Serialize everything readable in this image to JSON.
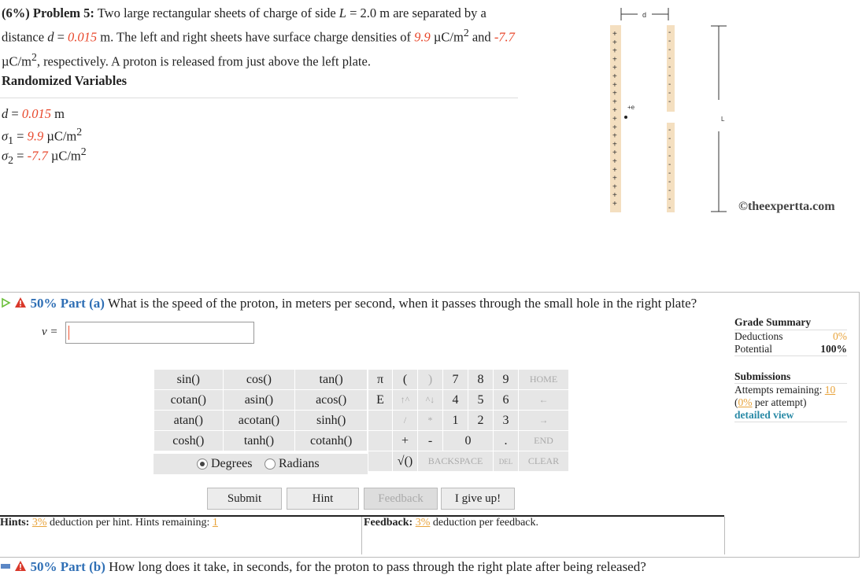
{
  "problem": {
    "header": "(6%) Problem 5:",
    "text_1": "Two large rectangular sheets of charge of side",
    "L_sym": "L",
    "text_2": "= 2.0 m are separated by a distance",
    "d_sym": "d",
    "d_eq": "=",
    "d_val": "0.015",
    "text_3": "m. The left and right sheets have surface charge densities of",
    "s1_val": "9.9",
    "s1_unit": "µC/m",
    "text_4": "and",
    "s2_val": "-7.7",
    "s2_unit": "µC/m",
    "text_5": ", respectively. A proton is released from just above the left plate.",
    "sq": "2"
  },
  "randomized": {
    "title": "Randomized Variables",
    "d_line": {
      "sym": "d",
      "eq": "=",
      "val": "0.015",
      "unit": "m"
    },
    "s1_line": {
      "sym": "σ",
      "sub": "1",
      "eq": "=",
      "val": "9.9",
      "unit": "µC/m",
      "sq": "2"
    },
    "s2_line": {
      "sym": "σ",
      "sub": "2",
      "eq": "=",
      "val": "-7.7",
      "unit": "µC/m",
      "sq": "2"
    }
  },
  "figure": {
    "d_label": "d",
    "proton_label": "+e",
    "L_label": "L",
    "watermark": "©theexpertta.com",
    "plus": "+",
    "minus": "-"
  },
  "part_a": {
    "percent_label": "50% Part (a)",
    "question": "What is the speed of the proton, in meters per second, when it passes through the small hole in the right plate?",
    "answer_var": "v =",
    "answer_value": ""
  },
  "keypad": {
    "func_rows": [
      [
        "sin()",
        "cos()",
        "tan()"
      ],
      [
        "cotan()",
        "asin()",
        "acos()"
      ],
      [
        "atan()",
        "acotan()",
        "sinh()"
      ],
      [
        "cosh()",
        "tanh()",
        "cotanh()"
      ]
    ],
    "degrees": "Degrees",
    "radians": "Radians",
    "pi": "π",
    "E": "E",
    "lparen": "(",
    "rparen": ")",
    "up1": "↑^",
    "up2": "^↓",
    "slash": "/",
    "star": "*",
    "plus": "+",
    "minus": "-",
    "sqrt": "√()",
    "digits": [
      "7",
      "8",
      "9",
      "4",
      "5",
      "6",
      "1",
      "2",
      "3",
      "0",
      "."
    ],
    "home": "HOME",
    "back_arrow": "←",
    "fwd_arrow": "→",
    "end": "END",
    "backspace": "BACKSPACE",
    "del": "DEL",
    "clear": "CLEAR"
  },
  "actions": {
    "submit": "Submit",
    "hint": "Hint",
    "feedback": "Feedback",
    "give_up": "I give up!"
  },
  "hints": {
    "hints_label": "Hints:",
    "hints_pct": "3%",
    "hints_text": "deduction per hint. Hints remaining:",
    "hints_remaining": "1",
    "feedback_label": "Feedback:",
    "feedback_pct": "3%",
    "feedback_text": "deduction per feedback."
  },
  "grade": {
    "title": "Grade Summary",
    "deductions_label": "Deductions",
    "deductions_val": "0%",
    "potential_label": "Potential",
    "potential_val": "100%",
    "submissions_title": "Submissions",
    "attempts_label": "Attempts remaining:",
    "attempts_val": "10",
    "per_attempt_open": "(",
    "per_attempt_pct": "0%",
    "per_attempt_text": "per attempt)",
    "detailed_view": "detailed view"
  },
  "part_b": {
    "percent_label": "50% Part (b)",
    "question": "How long does it take, in seconds, for the proton to pass through the right plate after being released?"
  },
  "colors": {
    "accent_red": "#e8472b",
    "part_blue": "#2f6fb5",
    "orange": "#e8a33b",
    "teal": "#2a8aa6"
  }
}
